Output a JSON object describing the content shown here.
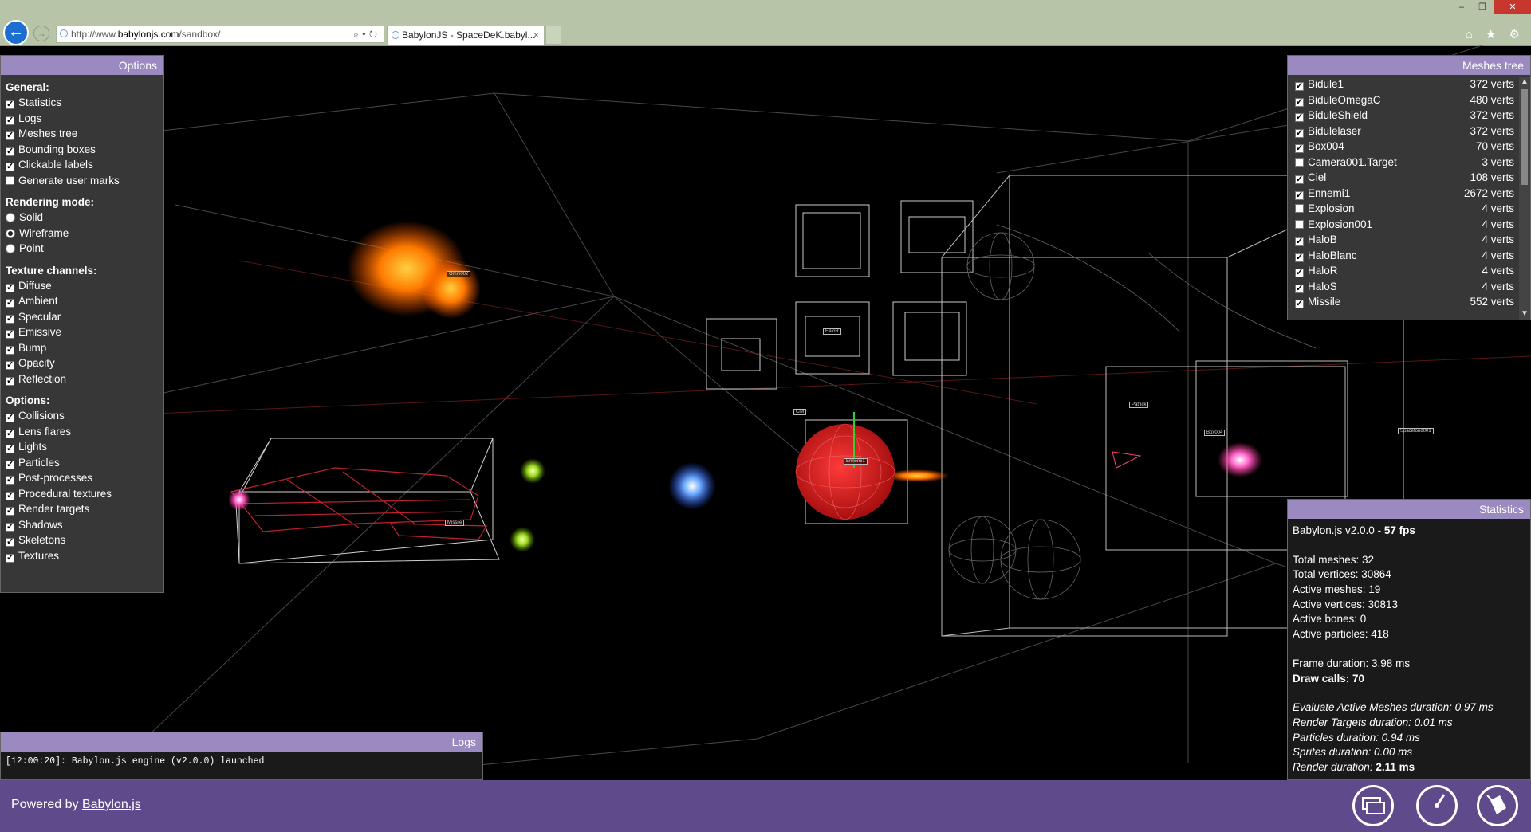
{
  "browser": {
    "address_prefix": "http://www.",
    "address_domain": "babylonjs.com",
    "address_path": "/sandbox/",
    "tab_title": "BabylonJS - SpaceDeK.babyl...",
    "tab_close": "×",
    "window_controls": [
      "–",
      "❐",
      "✕"
    ],
    "toolbar_icons": "⌂ ★ ⚙"
  },
  "options": {
    "header": "Options",
    "general_title": "General:",
    "general": [
      {
        "label": "Statistics",
        "checked": true
      },
      {
        "label": "Logs",
        "checked": true
      },
      {
        "label": "Meshes tree",
        "checked": true
      },
      {
        "label": "Bounding boxes",
        "checked": true
      },
      {
        "label": "Clickable labels",
        "checked": true
      },
      {
        "label": "Generate user marks",
        "checked": false
      }
    ],
    "rendering_title": "Rendering mode:",
    "rendering": [
      {
        "label": "Solid",
        "selected": false
      },
      {
        "label": "Wireframe",
        "selected": true
      },
      {
        "label": "Point",
        "selected": false
      }
    ],
    "texture_title": "Texture channels:",
    "texture": [
      {
        "label": "Diffuse",
        "checked": true
      },
      {
        "label": "Ambient",
        "checked": true
      },
      {
        "label": "Specular",
        "checked": true
      },
      {
        "label": "Emissive",
        "checked": true
      },
      {
        "label": "Bump",
        "checked": true
      },
      {
        "label": "Opacity",
        "checked": true
      },
      {
        "label": "Reflection",
        "checked": true
      }
    ],
    "options_title": "Options:",
    "options": [
      {
        "label": "Collisions",
        "checked": true
      },
      {
        "label": "Lens flares",
        "checked": true
      },
      {
        "label": "Lights",
        "checked": true
      },
      {
        "label": "Particles",
        "checked": true
      },
      {
        "label": "Post-processes",
        "checked": true
      },
      {
        "label": "Procedural textures",
        "checked": true
      },
      {
        "label": "Render targets",
        "checked": true
      },
      {
        "label": "Shadows",
        "checked": true
      },
      {
        "label": "Skeletons",
        "checked": true
      },
      {
        "label": "Textures",
        "checked": true
      }
    ]
  },
  "meshes": {
    "header": "Meshes tree",
    "items": [
      {
        "name": "Bidule1",
        "verts": "372 verts",
        "checked": true
      },
      {
        "name": "BiduleOmegaC",
        "verts": "480 verts",
        "checked": true
      },
      {
        "name": "BiduleShield",
        "verts": "372 verts",
        "checked": true
      },
      {
        "name": "Bidulelaser",
        "verts": "372 verts",
        "checked": true
      },
      {
        "name": "Box004",
        "verts": "70 verts",
        "checked": true
      },
      {
        "name": "Camera001.Target",
        "verts": "3 verts",
        "checked": false
      },
      {
        "name": "Ciel",
        "verts": "108 verts",
        "checked": true
      },
      {
        "name": "Ennemi1",
        "verts": "2672 verts",
        "checked": true
      },
      {
        "name": "Explosion",
        "verts": "4 verts",
        "checked": false
      },
      {
        "name": "Explosion001",
        "verts": "4 verts",
        "checked": false
      },
      {
        "name": "HaloB",
        "verts": "4 verts",
        "checked": true
      },
      {
        "name": "HaloBlanc",
        "verts": "4 verts",
        "checked": true
      },
      {
        "name": "HaloR",
        "verts": "4 verts",
        "checked": true
      },
      {
        "name": "HaloS",
        "verts": "4 verts",
        "checked": true
      },
      {
        "name": "Missile",
        "verts": "552 verts",
        "checked": true
      }
    ]
  },
  "stats": {
    "header": "Statistics",
    "version": "Babylon.js v2.0.0 - ",
    "fps": "57 fps",
    "total_meshes": "Total meshes: 32",
    "total_vertices": "Total vertices: 30864",
    "active_meshes": "Active meshes: 19",
    "active_vertices": "Active vertices: 30813",
    "active_bones": "Active bones: 0",
    "active_particles": "Active particles: 418",
    "frame_duration": "Frame duration: 3.98 ms",
    "draw_calls": "Draw calls: 70",
    "evaluate": "Evaluate Active Meshes duration: 0.97 ms",
    "render_targets": "Render Targets duration: 0.01 ms",
    "particles": "Particles duration: 0.94 ms",
    "sprites": "Sprites duration: 0.00 ms",
    "render_label": "Render duration: ",
    "render_value": "2.11 ms"
  },
  "logs": {
    "header": "Logs",
    "lines": [
      "[12:00:20]: Babylon.js engine (v2.0.0) launched"
    ]
  },
  "footer": {
    "powered_prefix": "Powered by ",
    "powered_link": "Babylon.js"
  },
  "scene_labels": [
    "Omni002",
    "Patrick",
    "Ciel",
    "Box004",
    "Spacefond001",
    "Ennemi1",
    "Missile",
    "HaloR"
  ],
  "colors": {
    "panel_header": "#9a8ac0",
    "footer": "#5f4b8b",
    "chrome": "#b7c4a8",
    "enemy_red": "#d81f1f"
  }
}
